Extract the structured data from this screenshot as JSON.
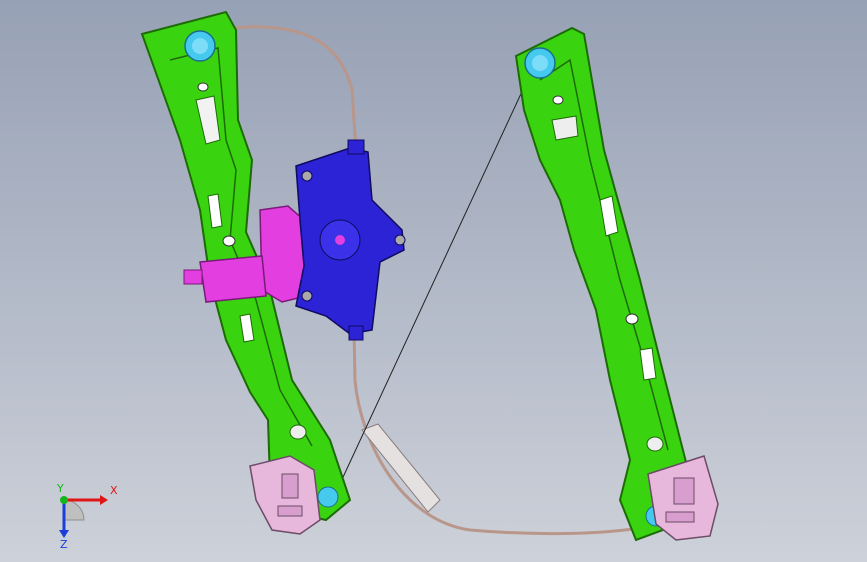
{
  "viewport": {
    "background_top": "#97a1b5",
    "background_bottom": "#cdd1d9"
  },
  "model": {
    "rail_color": "#39d40f",
    "rail_edge_color": "#1d6b06",
    "motor_color": "#e23ee0",
    "drum_color": "#2c22d6",
    "pulley_color": "#46c9ee",
    "slider_color": "#e7b7dc",
    "cable_color": "#b9968a"
  },
  "triad": {
    "x_label": "X",
    "y_label": "Y",
    "z_label": "Z",
    "x_color": "#e01515",
    "y_color": "#16b51e",
    "z_color": "#1d3ddb"
  }
}
